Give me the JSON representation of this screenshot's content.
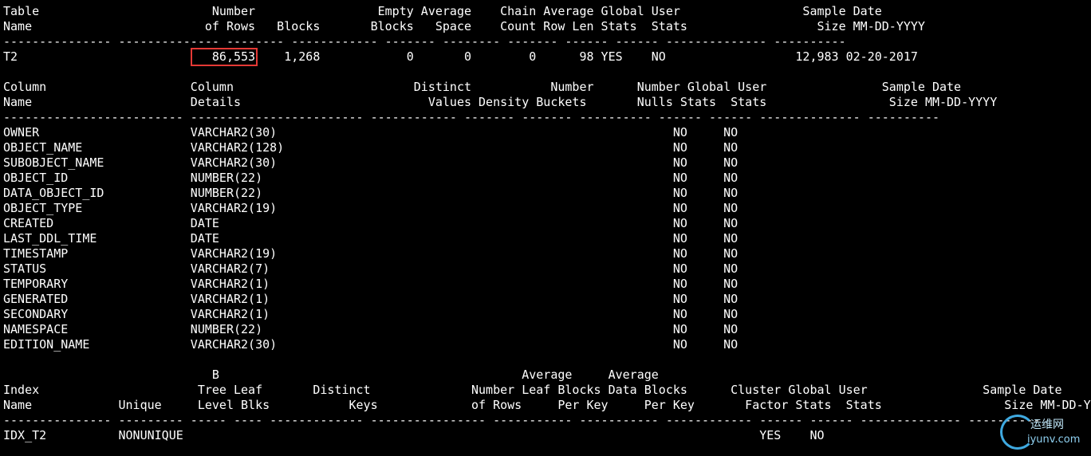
{
  "table_section": {
    "lines": [
      "Table                        Number                 Empty Average    Chain Average Global User                 Sample Date",
      "Name                        of Rows   Blocks       Blocks   Space    Count Row Len Stats  Stats                  Size MM-DD-YYYY",
      "--------------- -------------- -------- ------------ ------- -------- ------- ------ ------ -------------- ----------",
      "T2                           86,553    1,268            0       0        0      98 YES    NO                  12,983 02-20-2017"
    ]
  },
  "column_section": {
    "lines": [
      "Column                    Column                         Distinct           Number      Number Global User                Sample Date",
      "Name                      Details                          Values Density Buckets       Nulls Stats  Stats                 Size MM-DD-YYYY",
      "------------------------- ------------------------ ------------ ------- ------- ---------- ------ ------ -------------- ----------",
      "OWNER                     VARCHAR2(30)                                                       NO     NO",
      "OBJECT_NAME               VARCHAR2(128)                                                      NO     NO",
      "SUBOBJECT_NAME            VARCHAR2(30)                                                       NO     NO",
      "OBJECT_ID                 NUMBER(22)                                                         NO     NO",
      "DATA_OBJECT_ID            NUMBER(22)                                                         NO     NO",
      "OBJECT_TYPE               VARCHAR2(19)                                                       NO     NO",
      "CREATED                   DATE                                                               NO     NO",
      "LAST_DDL_TIME             DATE                                                               NO     NO",
      "TIMESTAMP                 VARCHAR2(19)                                                       NO     NO",
      "STATUS                    VARCHAR2(7)                                                        NO     NO",
      "TEMPORARY                 VARCHAR2(1)                                                        NO     NO",
      "GENERATED                 VARCHAR2(1)                                                        NO     NO",
      "SECONDARY                 VARCHAR2(1)                                                        NO     NO",
      "NAMESPACE                 NUMBER(22)                                                         NO     NO",
      "EDITION_NAME              VARCHAR2(30)                                                       NO     NO"
    ]
  },
  "index_section": {
    "lines": [
      "                             B                                          Average     Average",
      "Index                      Tree Leaf       Distinct              Number Leaf Blocks Data Blocks      Cluster Global User                Sample Date",
      "Name            Unique     Level Blks           Keys             of Rows     Per Key     Per Key       Factor Stats  Stats                 Size MM-DD-YYYY",
      "--------------- --------- ----- ---- ------------- ---------------- ----------- ----------- ------------ ------ ------ -------------- ----------",
      "IDX_T2          NONUNIQUE                                                                                YES    NO"
    ]
  },
  "watermark": {
    "cn": "运维网",
    "en": "iyunv.com"
  },
  "colors": {
    "background": "#000000",
    "text": "#ffffff",
    "highlight": "#e53935"
  }
}
